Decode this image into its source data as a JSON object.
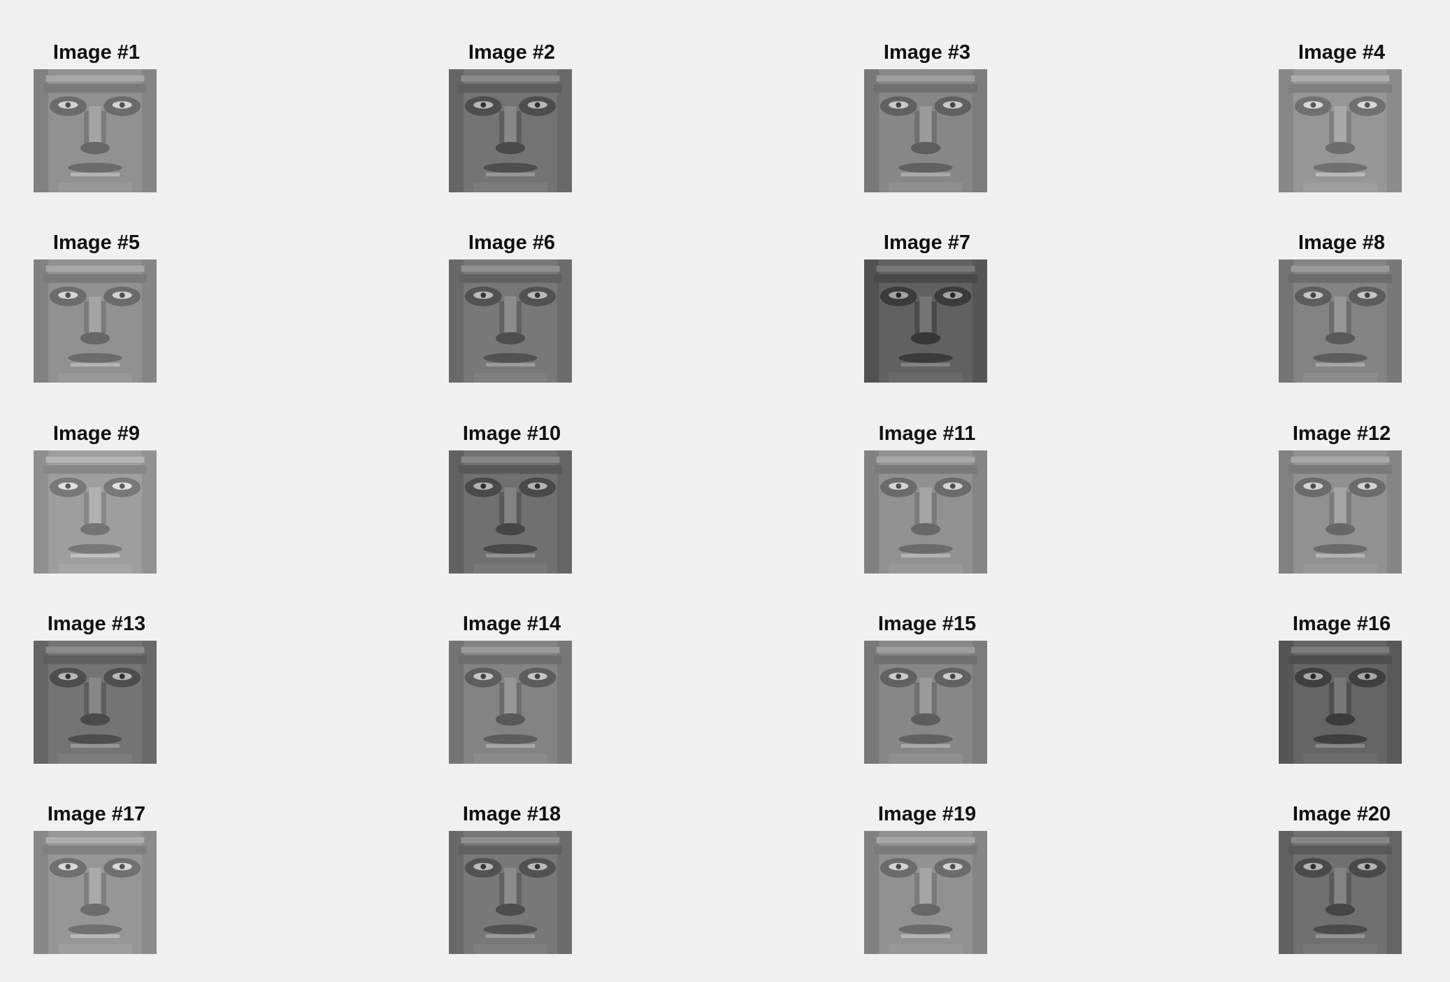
{
  "figure": {
    "background": "#f0f0f0",
    "images": [
      {
        "title": "Image #1",
        "tone": 0.55
      },
      {
        "title": "Image #2",
        "tone": 0.4
      },
      {
        "title": "Image #3",
        "tone": 0.5
      },
      {
        "title": "Image #4",
        "tone": 0.58
      },
      {
        "title": "Image #5",
        "tone": 0.55
      },
      {
        "title": "Image #6",
        "tone": 0.42
      },
      {
        "title": "Image #7",
        "tone": 0.3
      },
      {
        "title": "Image #8",
        "tone": 0.48
      },
      {
        "title": "Image #9",
        "tone": 0.62
      },
      {
        "title": "Image #10",
        "tone": 0.38
      },
      {
        "title": "Image #11",
        "tone": 0.55
      },
      {
        "title": "Image #12",
        "tone": 0.55
      },
      {
        "title": "Image #13",
        "tone": 0.4
      },
      {
        "title": "Image #14",
        "tone": 0.48
      },
      {
        "title": "Image #15",
        "tone": 0.5
      },
      {
        "title": "Image #16",
        "tone": 0.32
      },
      {
        "title": "Image #17",
        "tone": 0.58
      },
      {
        "title": "Image #18",
        "tone": 0.42
      },
      {
        "title": "Image #19",
        "tone": 0.55
      },
      {
        "title": "Image #20",
        "tone": 0.38
      }
    ]
  }
}
